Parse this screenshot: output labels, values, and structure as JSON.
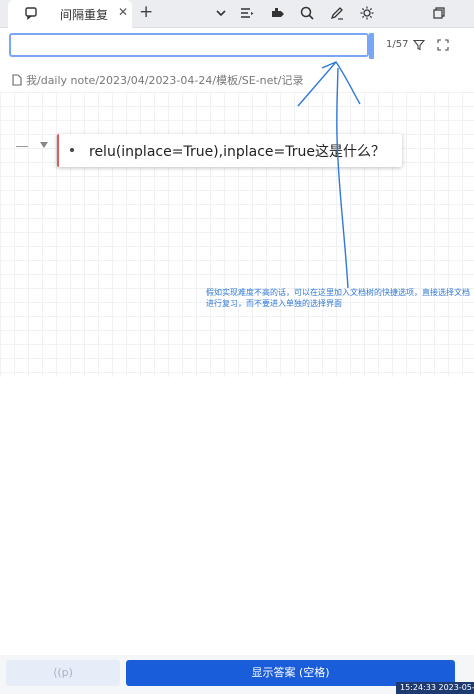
{
  "tab": {
    "title": "间隔重复",
    "close_icon": "close-icon",
    "add_icon": "plus-icon"
  },
  "toolbar": {
    "icons": [
      "list-icon",
      "puzzle-icon",
      "search-icon",
      "pen-icon",
      "brightness-icon",
      "restore-window-icon"
    ]
  },
  "search": {
    "value": "",
    "placeholder": "",
    "counter": "1/57",
    "filter_icon": "filter-icon",
    "expand_icon": "fullscreen-icon"
  },
  "breadcrumb": {
    "path": "我/daily note/2023/04/2023-04-24/模板/SE-net/记录"
  },
  "card": {
    "text": "relu(inplace=True),inplace=True这是什么？"
  },
  "annotation": {
    "text": "假如实现难度不高的话，可以在这里加入文档树的快捷选项，直接选择文档进行复习，而不要进入单独的选择界面",
    "color": "#2f78d8"
  },
  "bottom": {
    "prev_label": "⟨(p)",
    "show_label": "显示答案 (空格)",
    "timestamp": "15:24:33 2023-05-08"
  },
  "colors": {
    "accent": "#1a5ddb",
    "card_border": "#e05b5b",
    "focus": "#7aa7f5"
  }
}
